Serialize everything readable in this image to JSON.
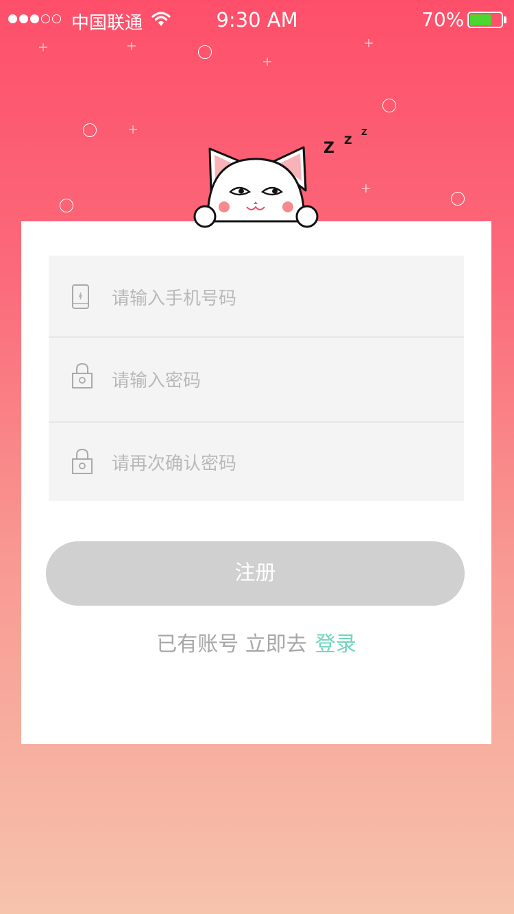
{
  "status_bar": {
    "carrier": "中国联通",
    "time": "9:30 AM",
    "battery_pct": "70%",
    "battery_level": 0.7,
    "signal_bars_filled": 3,
    "signal_bars_total": 5
  },
  "form": {
    "phone_placeholder": "请输入手机号码",
    "password_placeholder": "请输入密码",
    "confirm_placeholder": "请再次确认密码"
  },
  "register_button": "注册",
  "login_prompt": {
    "text": "已有账号 立即去",
    "link": "登录"
  },
  "icons": {
    "phone": "phone-icon",
    "lock": "lock-icon",
    "wifi": "wifi-icon",
    "mascot": "sleeping-cat-illustration"
  },
  "colors": {
    "gradient_top": "#fe4f6a",
    "gradient_bottom": "#f6c3ab",
    "link": "#6fd6be",
    "button_disabled": "#d0d0d0",
    "battery_fill": "#4cd630"
  }
}
